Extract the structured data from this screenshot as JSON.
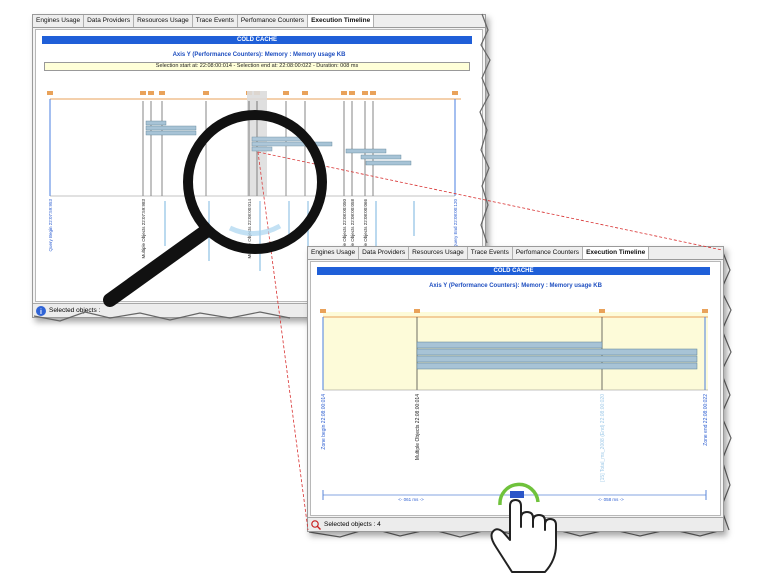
{
  "tabs": [
    {
      "label": "Engines Usage"
    },
    {
      "label": "Data Providers"
    },
    {
      "label": "Resources Usage"
    },
    {
      "label": "Trace Events"
    },
    {
      "label": "Perfomance Counters"
    },
    {
      "label": "Execution Timeline"
    }
  ],
  "active_tab": "Execution Timeline",
  "banner": "COLD CACHE",
  "axis_title": "Axis Y (Performance Counters): Memory : Memory usage KB",
  "selection_info": "Selection start at: 22:08:00:014 - Selection end at: 22:08:00:022 - Duration: 008 ms",
  "status": {
    "label": "Selected objects :",
    "zoom_label": "Selected objects : 4"
  },
  "zoom": {
    "range_left": "<- 061 ms ->",
    "range_right": "<- 058 ms ->",
    "labels": [
      "Zone begin 22:08:00:014",
      "Multiple Objects 22:08:00:014",
      "[15] Total_ms_2008 (End) 22:08:00:020",
      "Zone end 22:08:00:022"
    ]
  },
  "main_labels": [
    "Query Begin 22:07:59:953",
    "Multiple Objects 22:07:59:983",
    "Multiple Objects 22:08:00:014",
    "Multiple Objects 22:08:00:050",
    "Multiple Objects 22:08:00:058",
    "Multiple Objects 22:08:00:066",
    "Query End 22:08:00:120"
  ],
  "icons": [
    "magnifier-icon",
    "hand-pointer-icon",
    "info-icon",
    "search-icon"
  ],
  "colors": {
    "banner": "#1f5fd8",
    "bar": "#a7c3d6",
    "orange": "#e9a25a",
    "highlight": "#fdfbd9"
  }
}
